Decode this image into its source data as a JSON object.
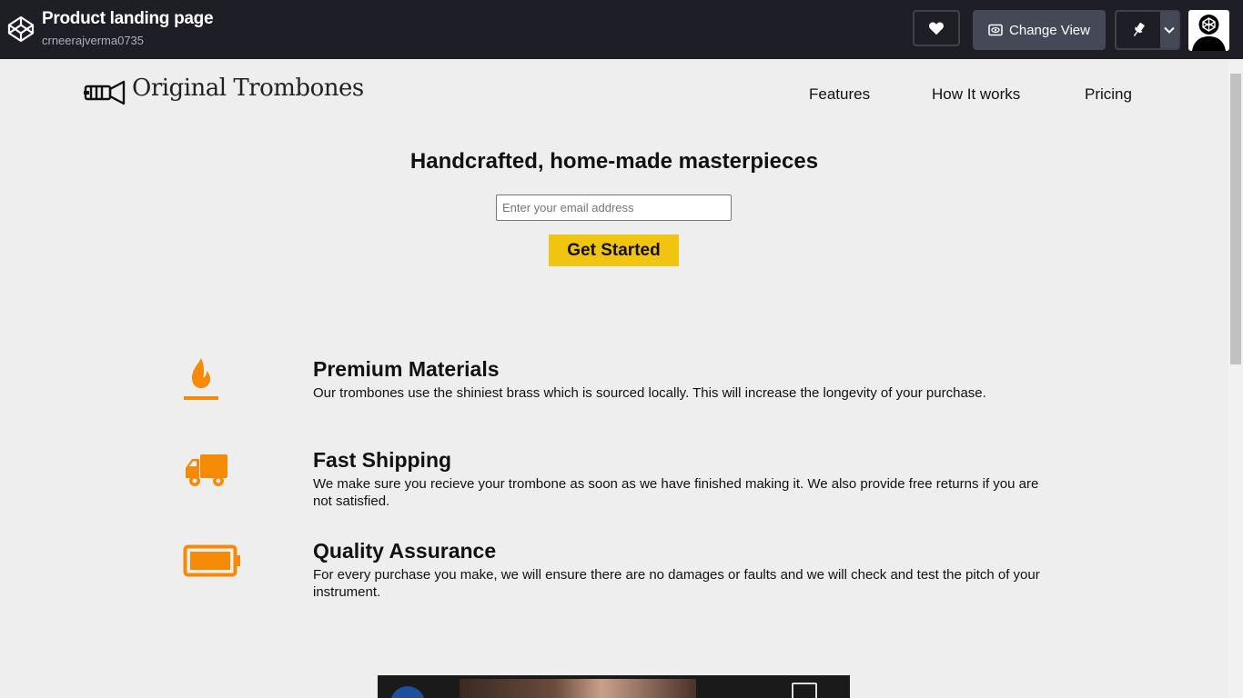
{
  "topbar": {
    "title": "Product landing page",
    "username": "crneerajverma0735",
    "change_view_label": "Change View",
    "icons": [
      "codepen-logo-icon",
      "heart-icon",
      "eye-icon",
      "pin-icon",
      "chevron-down-icon",
      "user-avatar-icon"
    ]
  },
  "brand": {
    "name": "Original Trombones",
    "icon": "trombone-logo-icon"
  },
  "nav": [
    {
      "label": "Features"
    },
    {
      "label": "How It works"
    },
    {
      "label": "Pricing"
    }
  ],
  "hero": {
    "title": "Handcrafted, home-made masterpieces",
    "email_placeholder": "Enter your email address",
    "cta_label": "Get Started"
  },
  "features": [
    {
      "icon": "fire-icon",
      "title": "Premium Materials",
      "desc": "Our trombones use the shiniest brass which is sourced locally. This will increase the longevity of your purchase."
    },
    {
      "icon": "truck-icon",
      "title": "Fast Shipping",
      "desc": "We make sure you recieve your trombone as soon as we have finished making it. We also provide free returns if you are not satisfied."
    },
    {
      "icon": "battery-icon",
      "title": "Quality Assurance",
      "desc": "For every purchase you make, we will ensure there are no damages or faults and we will check and test the pitch of your instrument."
    }
  ],
  "colors": {
    "accent": "#f1c40f",
    "icon": "#f58a07",
    "topbar": "#1e1f26",
    "page": "#eeeeee"
  }
}
